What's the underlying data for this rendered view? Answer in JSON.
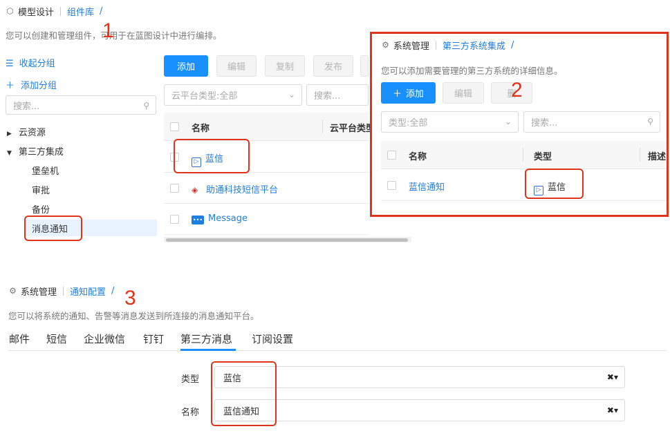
{
  "panel1": {
    "breadcrumb": {
      "root": "模型设计",
      "current": "组件库",
      "slash": "/"
    },
    "description": "您可以创建和管理组件，可用于在蓝图设计中进行编排。",
    "collapse_group": "收起分组",
    "add_group": "添加分组",
    "search_placeholder": "搜索...",
    "tree": {
      "cloud": "云资源",
      "third_party": "第三方集成",
      "children": [
        "堡垒机",
        "审批",
        "备份",
        "消息通知"
      ]
    },
    "toolbar": {
      "add": "添加",
      "edit": "编辑",
      "copy": "复制",
      "publish": "发布"
    },
    "filter_type": "云平台类型:全部",
    "filter_search": "搜索...",
    "table": {
      "headers": {
        "name": "名称",
        "type": "云平台类型"
      },
      "rows": [
        "蓝信",
        "助通科技短信平台",
        "Message"
      ]
    }
  },
  "panel2": {
    "breadcrumb": {
      "root": "系统管理",
      "current": "第三方系统集成",
      "slash": "/"
    },
    "description": "您可以添加需要管理的第三方系统的详细信息。",
    "toolbar": {
      "add": "添加",
      "edit": "编辑",
      "delete": "删"
    },
    "filter_type": "类型:全部",
    "filter_search": "搜索...",
    "table": {
      "headers": {
        "name": "名称",
        "type": "类型",
        "desc": "描述"
      },
      "rows": [
        {
          "name": "蓝信通知",
          "type": "蓝信"
        }
      ]
    }
  },
  "panel3": {
    "breadcrumb": {
      "root": "系统管理",
      "current": "通知配置",
      "slash": "/"
    },
    "description": "您可以将系统的通知、告警等消息发送到所连接的消息通知平台。",
    "tabs": [
      "邮件",
      "短信",
      "企业微信",
      "钉钉",
      "第三方消息",
      "订阅设置"
    ],
    "form": {
      "type_label": "类型",
      "type_value": "蓝信",
      "name_label": "名称",
      "name_value": "蓝信通知"
    }
  },
  "annotations": [
    "1",
    "2",
    "3"
  ],
  "colors": {
    "accent": "#1890ff",
    "link": "#1f7fe0",
    "annotation": "#e0341a"
  }
}
